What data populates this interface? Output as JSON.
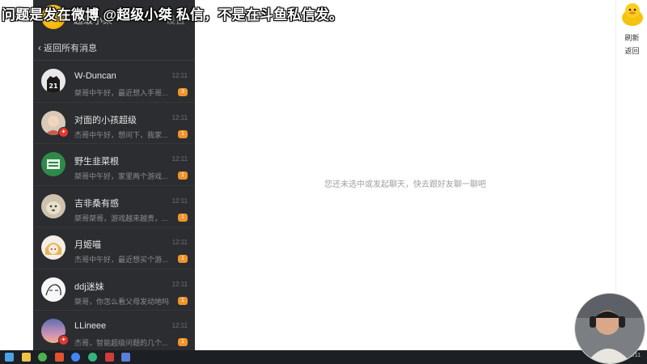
{
  "overlay": {
    "caption": "问题是发在微博 @超级小桀 私信，不是在斗鱼私信发。"
  },
  "panel": {
    "header": {
      "name": "超级小桀",
      "tools": "设置"
    },
    "back_label": "返回所有消息",
    "conversations": [
      {
        "name": "W-Duncan",
        "time": "12:11",
        "message": "桀哥中午好，最近想入手哥...",
        "count": "3",
        "avatar": "jersey-avatar",
        "verified": false
      },
      {
        "name": "对面的小孩超级",
        "time": "12:11",
        "message": "杰哥中午好，想问下，我家...",
        "count": "1",
        "avatar": "child-avatar",
        "verified": true
      },
      {
        "name": "野生韭菜根",
        "time": "12:11",
        "message": "桀哥中午好，家里两个游戏...",
        "count": "1",
        "avatar": "green-badge-avatar",
        "verified": false
      },
      {
        "name": "吉非桑有感",
        "time": "12:11",
        "message": "桀哥桀哥，游戏越来越贵，...",
        "count": "1",
        "avatar": "dog-avatar",
        "verified": false
      },
      {
        "name": "月姬喵",
        "time": "12:11",
        "message": "杰哥中午好，最近想买个游...",
        "count": "1",
        "avatar": "anime-girl-avatar",
        "verified": false
      },
      {
        "name": "ddj迷妹",
        "time": "12:11",
        "message": "桀哥，你怎么看父母发动地吗",
        "count": "1",
        "avatar": "sketch-avatar",
        "verified": false
      },
      {
        "name": "LLineee",
        "time": "12:11",
        "message": "杰哥，智能超级问题的几个...",
        "count": "1",
        "avatar": "sky-avatar",
        "verified": true
      }
    ]
  },
  "main": {
    "empty_text": "您还未选中或发起聊天，快去跟好友聊一聊吧"
  },
  "right_rail": {
    "refresh_label": "刷新",
    "back_label": "返回"
  },
  "taskbar": {
    "time": "2020/2/11"
  },
  "colors": {
    "panel_bg": "#2b2d30",
    "unread_badge": "#f0942a",
    "verified_badge": "#e4362f"
  }
}
